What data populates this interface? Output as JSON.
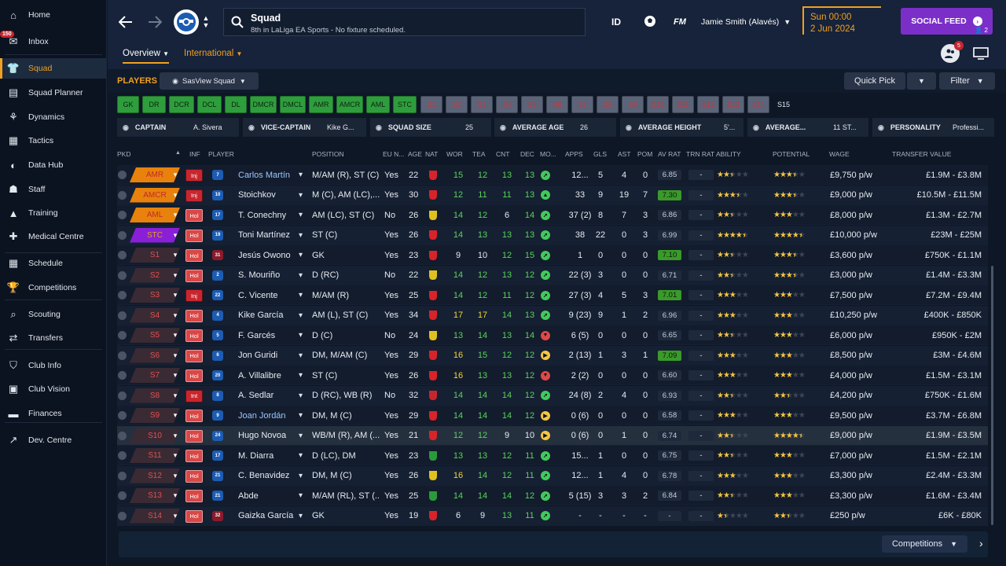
{
  "sidebar": {
    "items": [
      {
        "label": "Home",
        "icon": "home-icon",
        "badge": ""
      },
      {
        "label": "Inbox",
        "icon": "inbox-icon",
        "badge": "150"
      },
      {
        "label": "Squad",
        "icon": "shirt-icon",
        "badge": "",
        "active": true
      },
      {
        "label": "Squad Planner",
        "icon": "clipboard-icon"
      },
      {
        "label": "Dynamics",
        "icon": "dynamics-icon"
      },
      {
        "label": "Tactics",
        "icon": "tactics-board-icon"
      },
      {
        "label": "Data Hub",
        "icon": "data-hub-icon"
      },
      {
        "label": "Staff",
        "icon": "staff-icon"
      },
      {
        "label": "Training",
        "icon": "training-cone-icon"
      },
      {
        "label": "Medical Centre",
        "icon": "medical-kit-icon"
      },
      {
        "label": "Schedule",
        "icon": "calendar-icon"
      },
      {
        "label": "Competitions",
        "icon": "trophy-icon"
      },
      {
        "label": "Scouting",
        "icon": "magnifier-icon"
      },
      {
        "label": "Transfers",
        "icon": "transfer-arrows-icon"
      },
      {
        "label": "Club Info",
        "icon": "shield-icon"
      },
      {
        "label": "Club Vision",
        "icon": "briefcase-icon"
      },
      {
        "label": "Finances",
        "icon": "money-icon"
      },
      {
        "label": "Dev. Centre",
        "icon": "dev-centre-icon"
      }
    ]
  },
  "topbar": {
    "title": "Squad",
    "subtitle": "8th in LaLiga EA Sports - No fixture scheduled.",
    "id_label": "ID",
    "fm_label": "FM",
    "manager": "Jamie Smith (Alavés)",
    "date_time": "Sun 00:00",
    "date_day": "2 Jun 2024",
    "social_feed": "SOCIAL FEED",
    "social_count": "2",
    "notif_count": "5",
    "tabs": [
      "Overview",
      "International"
    ]
  },
  "players_bar": {
    "label": "PLAYERS",
    "view": "SasView Squad",
    "quick_pick": "Quick Pick",
    "filter": "Filter"
  },
  "position_chips": [
    {
      "label": "GK",
      "state": "g"
    },
    {
      "label": "DR",
      "state": "g"
    },
    {
      "label": "DCR",
      "state": "g"
    },
    {
      "label": "DCL",
      "state": "g"
    },
    {
      "label": "DL",
      "state": "g"
    },
    {
      "label": "DMCR",
      "state": "g"
    },
    {
      "label": "DMCL",
      "state": "g"
    },
    {
      "label": "AMR",
      "state": "g"
    },
    {
      "label": "AMCR",
      "state": "g"
    },
    {
      "label": "AML",
      "state": "g"
    },
    {
      "label": "STC",
      "state": "g"
    },
    {
      "label": "S1",
      "state": "x"
    },
    {
      "label": "S2",
      "state": "x"
    },
    {
      "label": "S3",
      "state": "x"
    },
    {
      "label": "S4",
      "state": "x"
    },
    {
      "label": "S5",
      "state": "x"
    },
    {
      "label": "S6",
      "state": "x"
    },
    {
      "label": "S7",
      "state": "x"
    },
    {
      "label": "S8",
      "state": "x"
    },
    {
      "label": "S9",
      "state": "x"
    },
    {
      "label": "S10",
      "state": "x"
    },
    {
      "label": "S11",
      "state": "x"
    },
    {
      "label": "S12",
      "state": "x"
    },
    {
      "label": "S13",
      "state": "x"
    },
    {
      "label": "S14",
      "state": "x"
    },
    {
      "label": "S15",
      "state": "n"
    }
  ],
  "info_strip": [
    {
      "label": "CAPTAIN",
      "value": "A. Sivera",
      "icon": "captain-icon"
    },
    {
      "label": "VICE-CAPTAIN",
      "value": "Kike G...",
      "icon": "vice-captain-icon"
    },
    {
      "label": "SQUAD SIZE",
      "value": "25",
      "icon": "squad-size-icon"
    },
    {
      "label": "AVERAGE AGE",
      "value": "26",
      "icon": "average-age-icon"
    },
    {
      "label": "AVERAGE HEIGHT",
      "value": "5'...",
      "icon": "height-icon"
    },
    {
      "label": "AVERAGE...",
      "value": "11 ST...",
      "icon": "weight-icon"
    },
    {
      "label": "PERSONALITY",
      "value": "Professi...",
      "icon": "personality-icon"
    }
  ],
  "table": {
    "headers": [
      "PKD",
      "INF",
      "PLAYER",
      "POSITION",
      "EU N...",
      "AGE",
      "NAT",
      "WOR",
      "TEA",
      "CNT",
      "DEC",
      "MO...",
      "APPS",
      "GLS",
      "AST",
      "POM",
      "AV RAT",
      "TRN RAT",
      "ABILITY",
      "POTENTIAL",
      "WAGE",
      "TRANSFER VALUE"
    ],
    "rows": [
      {
        "pkd": "AMR",
        "pkdc": "#e8820c",
        "inf": "Inj",
        "infc": "inj",
        "num": "7",
        "name": "Carlos Martín",
        "link": true,
        "pos": "M/AM (R), ST (C)",
        "eu": "Yes",
        "age": "22",
        "natc": "#d8232a",
        "wor": "15",
        "tea": "12",
        "cnt": "13",
        "dec": "13",
        "mo": "up",
        "apps": "12...",
        "gls": "5",
        "ast": "4",
        "pom": "0",
        "avr": "6.85",
        "avg": false,
        "trn": "-",
        "ab": 2.5,
        "pot": 3.5,
        "wage": "£9,750 p/w",
        "tv": "£1.9M - £3.8M"
      },
      {
        "pkd": "AMCR",
        "pkdc": "#e8820c",
        "inf": "Inj",
        "infc": "inj",
        "num": "10",
        "name": "Stoichkov",
        "pos": "M (C), AM (LC),...",
        "eu": "Yes",
        "age": "30",
        "natc": "#d8232a",
        "wor": "12",
        "tea": "11",
        "cnt": "11",
        "dec": "13",
        "mo": "sup",
        "apps": "33",
        "gls": "9",
        "ast": "19",
        "pom": "7",
        "avr": "7.30",
        "avg": true,
        "trn": "-",
        "ab": 3.5,
        "pot": 3.5,
        "wage": "£9,000 p/w",
        "tv": "£10.5M - £11.5M"
      },
      {
        "pkd": "AML",
        "pkdc": "#e8820c",
        "inf": "Hol",
        "infc": "hol",
        "num": "17",
        "name": "T. Conechny",
        "pos": "AM (LC), ST (C)",
        "eu": "No",
        "age": "26",
        "natc": "#e0c020",
        "wor": "14",
        "tea": "12",
        "cnt": "6",
        "dec": "14",
        "mo": "up",
        "apps": "37 (2)",
        "gls": "8",
        "ast": "7",
        "pom": "3",
        "avr": "6.86",
        "avg": false,
        "trn": "-",
        "ab": 2.5,
        "pot": 3,
        "wage": "£8,000 p/w",
        "tv": "£1.3M - £2.7M"
      },
      {
        "pkd": "STC",
        "pkdc": "#8a1fd8",
        "inf": "Hol",
        "infc": "hol",
        "num": "19",
        "name": "Toni Martínez",
        "pos": "ST (C)",
        "eu": "Yes",
        "age": "26",
        "natc": "#d8232a",
        "wor": "14",
        "tea": "13",
        "cnt": "13",
        "dec": "13",
        "mo": "up",
        "apps": "38",
        "gls": "22",
        "ast": "0",
        "pom": "3",
        "avr": "6.99",
        "avg": false,
        "trn": "-",
        "ab": 4.5,
        "pot": 4.5,
        "wage": "£10,000 p/w",
        "tv": "£23M - £25M"
      },
      {
        "pkd": "S1",
        "pkdc": "#3a2a34",
        "inf": "Hol",
        "infc": "hol",
        "num": "31",
        "name": "Jesús Owono",
        "pos": "GK",
        "eu": "Yes",
        "age": "23",
        "natc": "#d8232a",
        "wor": "9",
        "tea": "10",
        "cnt": "12",
        "dec": "15",
        "mo": "up",
        "apps": "1",
        "gls": "0",
        "ast": "0",
        "pom": "0",
        "avr": "7.10",
        "avg": true,
        "trn": "-",
        "ab": 2.5,
        "pot": 3.5,
        "wage": "£3,600 p/w",
        "tv": "£750K - £1.1M"
      },
      {
        "pkd": "S2",
        "pkdc": "#3a2a34",
        "inf": "Hol",
        "infc": "hol",
        "num": "2",
        "name": "S. Mouriño",
        "pos": "D (RC)",
        "eu": "No",
        "age": "22",
        "natc": "#e0c020",
        "wor": "14",
        "tea": "12",
        "cnt": "13",
        "dec": "12",
        "mo": "up",
        "apps": "22 (3)",
        "gls": "3",
        "ast": "0",
        "pom": "0",
        "avr": "6.71",
        "avg": false,
        "trn": "-",
        "ab": 2.5,
        "pot": 3.5,
        "wage": "£3,000 p/w",
        "tv": "£1.4M - £3.3M"
      },
      {
        "pkd": "S3",
        "pkdc": "#3a2a34",
        "inf": "Inj",
        "infc": "inj",
        "num": "22",
        "name": "C. Vicente",
        "pos": "M/AM (R)",
        "eu": "Yes",
        "age": "25",
        "natc": "#d8232a",
        "wor": "14",
        "tea": "12",
        "cnt": "11",
        "dec": "12",
        "mo": "up",
        "apps": "27 (3)",
        "gls": "4",
        "ast": "5",
        "pom": "3",
        "avr": "7.01",
        "avg": true,
        "trn": "-",
        "ab": 3,
        "pot": 3,
        "wage": "£7,500 p/w",
        "tv": "£7.2M - £9.4M"
      },
      {
        "pkd": "S4",
        "pkdc": "#3a2a34",
        "inf": "Hol",
        "infc": "hol",
        "num": "4",
        "name": "Kike García",
        "pos": "AM (L), ST (C)",
        "eu": "Yes",
        "age": "34",
        "natc": "#d8232a",
        "wor": "17",
        "tea": "17",
        "cnt": "14",
        "dec": "13",
        "mo": "up",
        "apps": "9 (23)",
        "gls": "9",
        "ast": "1",
        "pom": "2",
        "avr": "6.96",
        "avg": false,
        "trn": "-",
        "ab": 3,
        "pot": 3,
        "wage": "£10,250 p/w",
        "tv": "£400K - £850K"
      },
      {
        "pkd": "S5",
        "pkdc": "#3a2a34",
        "inf": "Hol",
        "infc": "hol",
        "num": "5",
        "name": "F. Garcés",
        "pos": "D (C)",
        "eu": "No",
        "age": "24",
        "natc": "#e0c020",
        "wor": "13",
        "tea": "14",
        "cnt": "13",
        "dec": "14",
        "mo": "down",
        "apps": "6 (5)",
        "gls": "0",
        "ast": "0",
        "pom": "0",
        "avr": "6.65",
        "avg": false,
        "trn": "-",
        "ab": 2.5,
        "pot": 3,
        "wage": "£6,000 p/w",
        "tv": "£950K - £2M"
      },
      {
        "pkd": "S6",
        "pkdc": "#3a2a34",
        "inf": "Hol",
        "infc": "hol",
        "num": "6",
        "name": "Jon Guridi",
        "pos": "DM, M/AM (C)",
        "eu": "Yes",
        "age": "29",
        "natc": "#d8232a",
        "wor": "16",
        "tea": "15",
        "cnt": "12",
        "dec": "12",
        "mo": "right",
        "apps": "2 (13)",
        "gls": "1",
        "ast": "3",
        "pom": "1",
        "avr": "7.09",
        "avg": true,
        "trn": "-",
        "ab": 3,
        "pot": 3,
        "wage": "£8,500 p/w",
        "tv": "£3M - £4.6M"
      },
      {
        "pkd": "S7",
        "pkdc": "#3a2a34",
        "inf": "Hol",
        "infc": "hol",
        "num": "20",
        "name": "A. Villalibre",
        "pos": "ST (C)",
        "eu": "Yes",
        "age": "26",
        "natc": "#d8232a",
        "wor": "16",
        "tea": "13",
        "cnt": "13",
        "dec": "12",
        "mo": "down",
        "apps": "2 (2)",
        "gls": "0",
        "ast": "0",
        "pom": "0",
        "avr": "6.60",
        "avg": false,
        "trn": "-",
        "ab": 3,
        "pot": 3,
        "wage": "£4,000 p/w",
        "tv": "£1.5M - £3.1M"
      },
      {
        "pkd": "S8",
        "pkdc": "#3a2a34",
        "inf": "Int",
        "infc": "int",
        "num": "8",
        "name": "A. Sedlar",
        "pos": "D (RC), WB (R)",
        "eu": "No",
        "age": "32",
        "natc": "#c8262f",
        "wor": "14",
        "tea": "14",
        "cnt": "14",
        "dec": "12",
        "mo": "up",
        "apps": "24 (8)",
        "gls": "2",
        "ast": "4",
        "pom": "0",
        "avr": "6.93",
        "avg": false,
        "trn": "-",
        "ab": 2.5,
        "pot": 2.5,
        "wage": "£4,200 p/w",
        "tv": "£750K - £1.6M"
      },
      {
        "pkd": "S9",
        "pkdc": "#3a2a34",
        "inf": "Hol",
        "infc": "hol",
        "num": "9",
        "name": "Joan Jordán",
        "link": true,
        "pos": "DM, M (C)",
        "eu": "Yes",
        "age": "29",
        "natc": "#d8232a",
        "wor": "14",
        "tea": "14",
        "cnt": "14",
        "dec": "12",
        "mo": "right",
        "apps": "0 (6)",
        "gls": "0",
        "ast": "0",
        "pom": "0",
        "avr": "6.58",
        "avg": false,
        "trn": "-",
        "ab": 3,
        "pot": 3,
        "wage": "£9,500 p/w",
        "tv": "£3.7M - £6.8M"
      },
      {
        "pkd": "S10",
        "pkdc": "#3a2a34",
        "inf": "Hol",
        "infc": "hol",
        "num": "24",
        "name": "Hugo Novoa",
        "pos": "WB/M (R), AM (...",
        "eu": "Yes",
        "age": "21",
        "natc": "#d8232a",
        "wor": "12",
        "tea": "12",
        "cnt": "9",
        "dec": "10",
        "mo": "right",
        "apps": "0 (6)",
        "gls": "0",
        "ast": "1",
        "pom": "0",
        "avr": "6.74",
        "avg": false,
        "trn": "-",
        "ab": 2.5,
        "pot": 4.5,
        "wage": "£9,000 p/w",
        "tv": "£1.9M - £3.5M",
        "hl": true
      },
      {
        "pkd": "S11",
        "pkdc": "#3a2a34",
        "inf": "Hol",
        "infc": "hol",
        "num": "17",
        "name": "M. Diarra",
        "pos": "D (LC), DM",
        "eu": "Yes",
        "age": "23",
        "natc": "#2a9a3a",
        "wor": "13",
        "tea": "13",
        "cnt": "12",
        "dec": "11",
        "mo": "up",
        "apps": "15...",
        "gls": "1",
        "ast": "0",
        "pom": "0",
        "avr": "6.75",
        "avg": false,
        "trn": "-",
        "ab": 2.5,
        "pot": 3,
        "wage": "£7,000 p/w",
        "tv": "£1.5M - £2.1M"
      },
      {
        "pkd": "S12",
        "pkdc": "#3a2a34",
        "inf": "Hol",
        "infc": "hol",
        "num": "21",
        "name": "C. Benavidez",
        "pos": "DM, M (C)",
        "eu": "Yes",
        "age": "26",
        "natc": "#e0c020",
        "wor": "16",
        "tea": "14",
        "cnt": "12",
        "dec": "11",
        "mo": "up",
        "apps": "12...",
        "gls": "1",
        "ast": "4",
        "pom": "0",
        "avr": "6.78",
        "avg": false,
        "trn": "-",
        "ab": 3,
        "pot": 3,
        "wage": "£3,300 p/w",
        "tv": "£2.4M - £3.3M"
      },
      {
        "pkd": "S13",
        "pkdc": "#3a2a34",
        "inf": "Hol",
        "infc": "hol",
        "num": "21",
        "name": "Abde",
        "pos": "M/AM (RL), ST (...",
        "eu": "Yes",
        "age": "25",
        "natc": "#2a9a3a",
        "wor": "14",
        "tea": "14",
        "cnt": "14",
        "dec": "12",
        "mo": "up",
        "apps": "5 (15)",
        "gls": "3",
        "ast": "3",
        "pom": "2",
        "avr": "6.84",
        "avg": false,
        "trn": "-",
        "ab": 2.5,
        "pot": 3,
        "wage": "£3,300 p/w",
        "tv": "£1.6M - £3.4M"
      },
      {
        "pkd": "S14",
        "pkdc": "#3a2a34",
        "inf": "Hol",
        "infc": "hol",
        "num": "32",
        "name": "Gaizka García",
        "pos": "GK",
        "eu": "Yes",
        "age": "19",
        "natc": "#d8232a",
        "wor": "6",
        "tea": "9",
        "cnt": "13",
        "dec": "11",
        "mo": "up",
        "apps": "-",
        "gls": "-",
        "ast": "-",
        "pom": "-",
        "avr": "-",
        "avg": false,
        "trn": "-",
        "ab": 1.5,
        "pot": 2.5,
        "wage": "£250 p/w",
        "tv": "£6K - £80K"
      }
    ]
  },
  "bottom": {
    "competitions": "Competitions"
  },
  "colors": {
    "accent": "#f0a020",
    "social": "#7b2fc8",
    "good": "#5bd35b",
    "great": "#f5c542"
  }
}
